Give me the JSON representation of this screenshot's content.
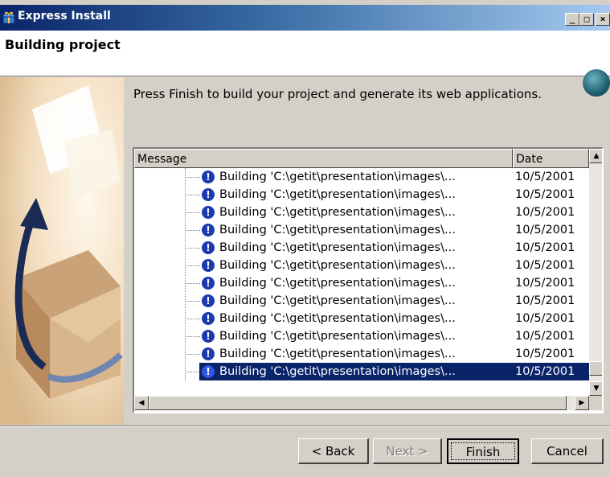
{
  "window": {
    "title": "Express Install",
    "controls": {
      "minimize": "_",
      "maximize": "□",
      "close": "×"
    }
  },
  "header": {
    "title": "Building project"
  },
  "content": {
    "description": "Press Finish to build your project and generate its web applications."
  },
  "listview": {
    "columns": [
      "Message",
      "Date"
    ],
    "rows": [
      {
        "message": "Building 'C:\\getit\\presentation\\images\\...",
        "date": "10/5/2001"
      },
      {
        "message": "Building 'C:\\getit\\presentation\\images\\...",
        "date": "10/5/2001"
      },
      {
        "message": "Building 'C:\\getit\\presentation\\images\\...",
        "date": "10/5/2001"
      },
      {
        "message": "Building 'C:\\getit\\presentation\\images\\...",
        "date": "10/5/2001"
      },
      {
        "message": "Building 'C:\\getit\\presentation\\images\\...",
        "date": "10/5/2001"
      },
      {
        "message": "Building 'C:\\getit\\presentation\\images\\...",
        "date": "10/5/2001"
      },
      {
        "message": "Building 'C:\\getit\\presentation\\images\\...",
        "date": "10/5/2001"
      },
      {
        "message": "Building 'C:\\getit\\presentation\\images\\...",
        "date": "10/5/2001"
      },
      {
        "message": "Building 'C:\\getit\\presentation\\images\\...",
        "date": "10/5/2001"
      },
      {
        "message": "Building 'C:\\getit\\presentation\\images\\...",
        "date": "10/5/2001"
      },
      {
        "message": "Building 'C:\\getit\\presentation\\images\\...",
        "date": "10/5/2001"
      },
      {
        "message": "Building 'C:\\getit\\presentation\\images\\...",
        "date": "10/5/2001"
      }
    ],
    "selected_index": 11,
    "row_icon": "info-icon"
  },
  "buttons": {
    "back": "< Back",
    "next": "Next >",
    "finish": "Finish",
    "cancel": "Cancel"
  },
  "colors": {
    "selection": "#0a246a",
    "info_icon": "#1b3ab0",
    "face": "#d4d0c8"
  }
}
